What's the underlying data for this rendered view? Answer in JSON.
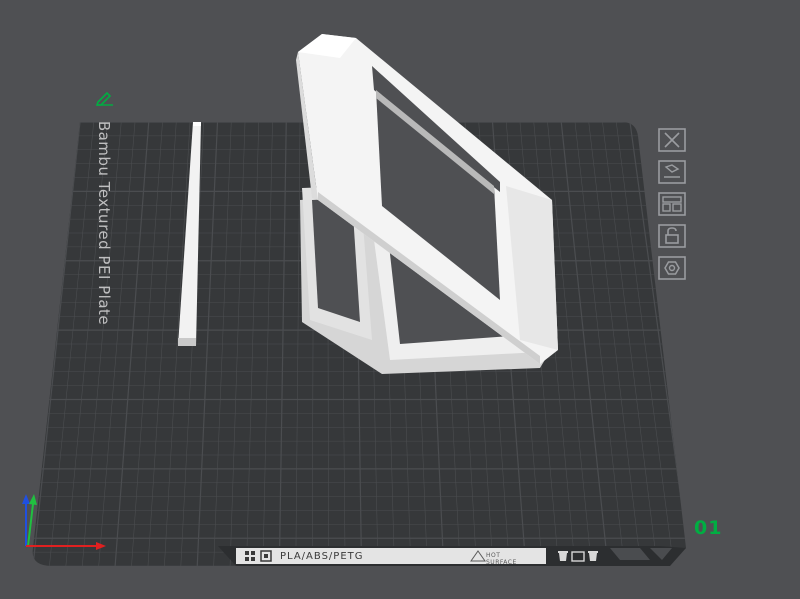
{
  "plate": {
    "label": "Bambu Textured PEI Plate",
    "index": "01",
    "bed_text": "PLA/ABS/PETG",
    "hot_line1": "HOT",
    "hot_line2": "SURFACE"
  },
  "plate_tools": [
    {
      "name": "delete-plate-button",
      "icon": "close-icon"
    },
    {
      "name": "auto-orient-button",
      "icon": "orient-icon"
    },
    {
      "name": "arrange-button",
      "icon": "arrange-icon"
    },
    {
      "name": "lock-plate-button",
      "icon": "lock-icon"
    },
    {
      "name": "plate-settings-button",
      "icon": "gear-icon"
    }
  ],
  "colors": {
    "background": "#4f5053",
    "plate": "#36383a",
    "grid": "#4b4d50",
    "model": "#e7e7e7",
    "accent": "#00ae42",
    "axis_x": "#e02020",
    "axis_y": "#20c040",
    "axis_z": "#2050e0"
  }
}
